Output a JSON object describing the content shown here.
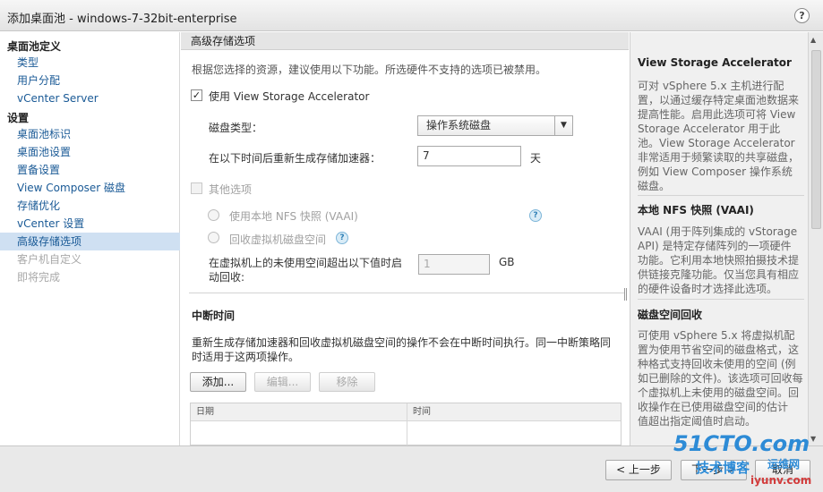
{
  "window": {
    "title": "添加桌面池 - windows-7-32bit-enterprise",
    "help_glyph": "?"
  },
  "sidebar": {
    "sections": [
      {
        "label": "桌面池定义",
        "items": [
          {
            "label": "类型",
            "state": "normal"
          },
          {
            "label": "用户分配",
            "state": "normal"
          },
          {
            "label": "vCenter Server",
            "state": "normal"
          }
        ]
      },
      {
        "label": "设置",
        "items": [
          {
            "label": "桌面池标识",
            "state": "normal"
          },
          {
            "label": "桌面池设置",
            "state": "normal"
          },
          {
            "label": "置备设置",
            "state": "normal"
          },
          {
            "label": "View Composer 磁盘",
            "state": "normal"
          },
          {
            "label": "存储优化",
            "state": "normal"
          },
          {
            "label": "vCenter 设置",
            "state": "normal"
          },
          {
            "label": "高级存储选项",
            "state": "active"
          },
          {
            "label": "客户机自定义",
            "state": "disabled"
          },
          {
            "label": "即将完成",
            "state": "disabled"
          }
        ]
      }
    ]
  },
  "main": {
    "header": "高级存储选项",
    "intro": "根据您选择的资源，建议使用以下功能。所选硬件不支持的选项已被禁用。",
    "vsa_checkbox": {
      "label": "使用 View Storage Accelerator",
      "checked": true,
      "mark": "✓"
    },
    "disk_type": {
      "label": "磁盘类型：",
      "value": "操作系统磁盘",
      "arrow": "▼"
    },
    "regen": {
      "label": "在以下时间后重新生成存储加速器：",
      "value": "7",
      "unit": "天"
    },
    "other_options": {
      "label": "其他选项",
      "nfs_radio": "使用本地 NFS 快照 (VAAI)",
      "reclaim_radio": "回收虚拟机磁盘空间",
      "reclaim_threshold_label_line1": "在虚拟机上的未使用空间超出以下值时启",
      "reclaim_threshold_label_line2": "动回收:",
      "reclaim_threshold_value": "1",
      "reclaim_unit": "GB"
    },
    "help_glyph": "?",
    "blackout": {
      "title": "中断时间",
      "desc_line1": "重新生成存储加速器和回收虚拟机磁盘空间的操作不会在中断时间执行。同一中断策略同",
      "desc_line2": "时适用于这两项操作。",
      "buttons": {
        "add": "添加...",
        "edit": "编辑...",
        "remove": "移除"
      },
      "columns": [
        "日期",
        "时间"
      ]
    }
  },
  "help_panel": {
    "sections": [
      {
        "title": "View Storage Accelerator",
        "lines": [
          "可对 vSphere 5.x 主机进行配",
          "置，以通过缓存特定桌面池数据来",
          "提高性能。启用此选项可将 View",
          "Storage Accelerator 用于此",
          "池。View Storage Accelerator",
          "非常适用于频繁读取的共享磁盘，",
          "例如 View Composer 操作系统",
          "磁盘。"
        ]
      },
      {
        "title": "本地 NFS 快照 (VAAI)",
        "lines": [
          "VAAI (用于阵列集成的 vStorage",
          "API) 是特定存储阵列的一项硬件",
          "功能。它利用本地快照拍摄技术提",
          "供链接克隆功能。仅当您具有相应",
          "的硬件设备时才选择此选项。"
        ]
      },
      {
        "title": "磁盘空间回收",
        "lines": [
          "可使用 vSphere 5.x 将虚拟机配",
          "置为使用节省空间的磁盘格式，这",
          "种格式支持回收未使用的空间 (例",
          "如已删除的文件)。该选项可回收每",
          "个虚拟机上未使用的磁盘空间。回",
          "收操作在已使用磁盘空间的估计",
          "值超出指定阈值时启动。"
        ]
      }
    ]
  },
  "footer": {
    "back": "< 上一步",
    "next": "下一步 >",
    "cancel": "取消"
  },
  "watermark": {
    "brand": "51CTO.com",
    "line2": "技术博客",
    "site_label": "运维网",
    "site_url": "iyunv.com"
  },
  "colors": {
    "accent_link": "#1a5a96",
    "active_bg": "#cfe0f2",
    "watermark_blue": "#2d8bd6",
    "watermark_red": "#d23b3b"
  }
}
